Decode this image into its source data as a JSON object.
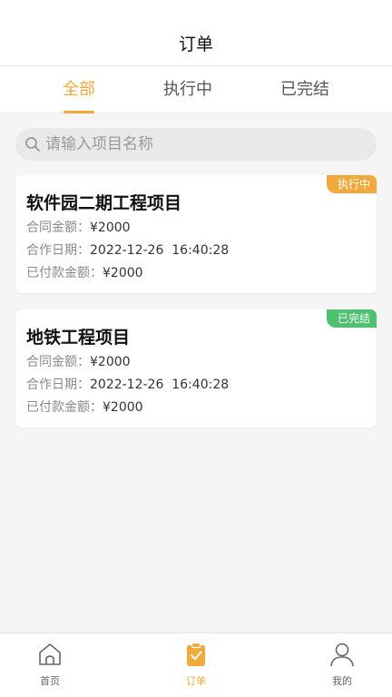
{
  "header": {
    "title": "订单"
  },
  "tabs": [
    {
      "label": "全部",
      "active": true
    },
    {
      "label": "执行中",
      "active": false
    },
    {
      "label": "已完结",
      "active": false
    }
  ],
  "search": {
    "placeholder": "请输入项目名称",
    "value": ""
  },
  "orders": [
    {
      "name": "软件园二期工程项目",
      "status": "执行中",
      "status_color": "#f0a93a",
      "contract_label": "合同金额：",
      "contract_amount": "¥2000",
      "date_label": "合作日期：",
      "date": "2022-12-26  16:40:28",
      "paid_label": "已付款金额：",
      "paid_amount": "¥2000"
    },
    {
      "name": "地铁工程项目",
      "status": "已完结",
      "status_color": "#4cc26e",
      "contract_label": "合同金额：",
      "contract_amount": "¥2000",
      "date_label": "合作日期：",
      "date": "2022-12-26  16:40:28",
      "paid_label": "已付款金额：",
      "paid_amount": "¥2000"
    }
  ],
  "nav": [
    {
      "label": "首页",
      "icon": "home-icon",
      "active": false
    },
    {
      "label": "订单",
      "icon": "orders-clipboard-icon",
      "active": true
    },
    {
      "label": "我的",
      "icon": "profile-icon",
      "active": false
    }
  ],
  "colors": {
    "accent": "#f0a93a",
    "done": "#4cc26e",
    "background": "#f5f5f5"
  }
}
